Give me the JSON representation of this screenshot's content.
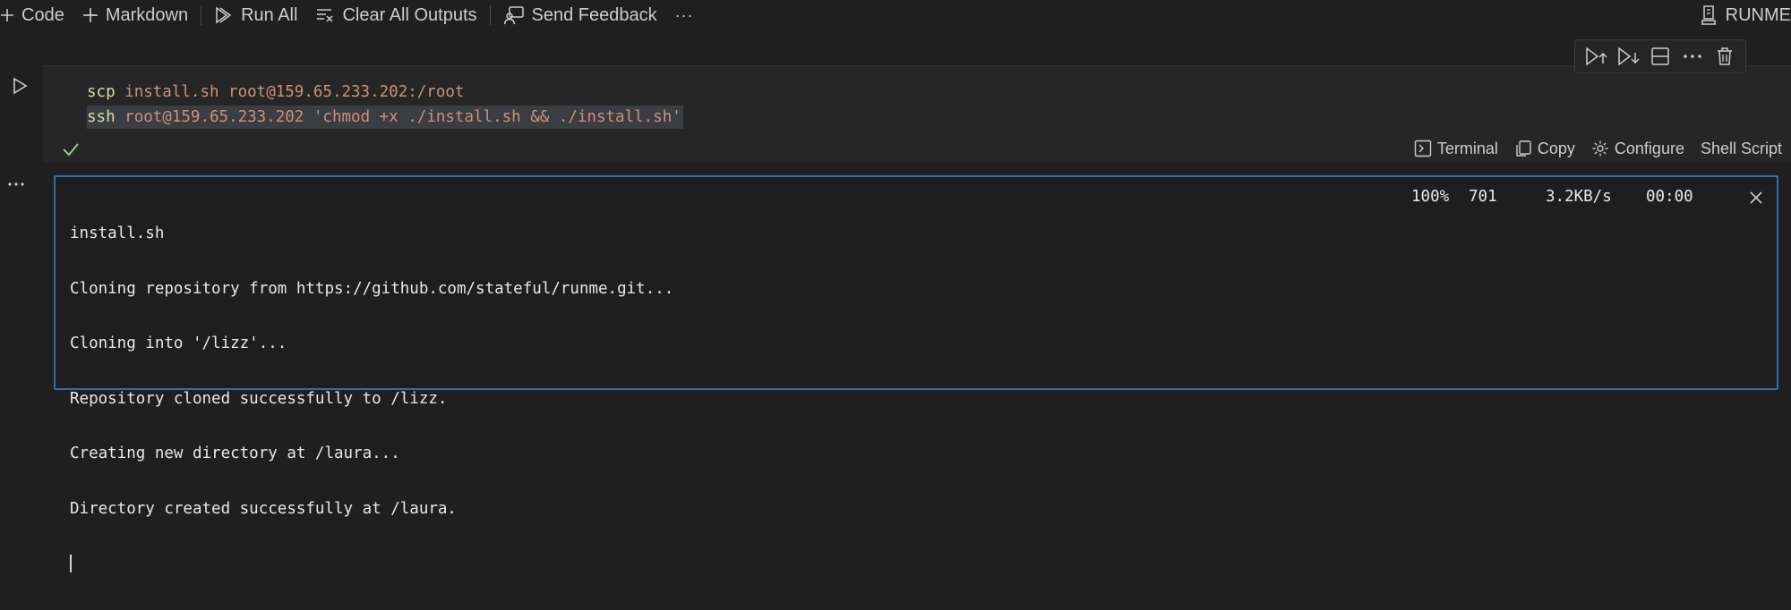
{
  "toolbar": {
    "code_label": "Code",
    "markdown_label": "Markdown",
    "run_all_label": "Run All",
    "clear_outputs_label": "Clear All Outputs",
    "feedback_label": "Send Feedback",
    "more_label": "···",
    "kernel_label": "RUNME"
  },
  "cell": {
    "code_lines": [
      {
        "cmd": "scp",
        "args": "install.sh root@159.65.233.202:/root"
      },
      {
        "cmd": "ssh",
        "args": "root@159.65.233.202",
        "string": "'chmod +x ./install.sh && ./install.sh'"
      }
    ],
    "status": {
      "terminal_label": "Terminal",
      "copy_label": "Copy",
      "configure_label": "Configure",
      "language_label": "Shell Script"
    }
  },
  "output": {
    "lines": [
      "install.sh",
      "Cloning repository from https://github.com/stateful/runme.git...",
      "Cloning into '/lizz'...",
      "Repository cloned successfully to /lizz.",
      "Creating new directory at /laura...",
      "Directory created successfully at /laura."
    ],
    "progress": {
      "percent": "100%",
      "bytes": "701",
      "rate": "3.2KB/s",
      "eta": "00:00"
    }
  },
  "colors": {
    "background": "#1f1f1f",
    "editor_bg": "#262626",
    "focus_border": "#2f6fad",
    "success": "#89d185",
    "command": "#dcdcaa",
    "argument": "#ce9178"
  },
  "icons": [
    "plus-icon",
    "run-all-icon",
    "clear-outputs-icon",
    "feedback-icon",
    "kernel-icon",
    "run-cell-icon",
    "execute-above-icon",
    "execute-below-icon",
    "split-cell-icon",
    "more-icon",
    "delete-icon",
    "check-icon",
    "terminal-icon",
    "copy-icon",
    "gear-icon",
    "close-icon"
  ]
}
